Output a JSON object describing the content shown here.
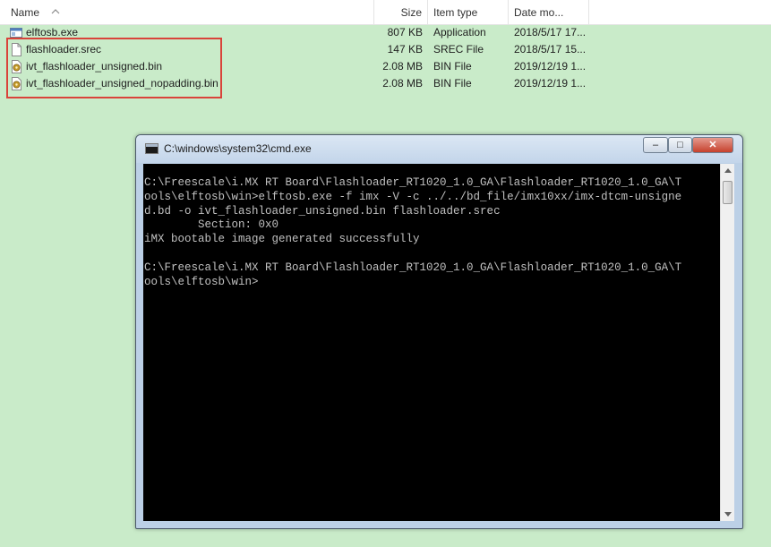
{
  "header": {
    "name": "Name",
    "size": "Size",
    "type": "Item type",
    "date": "Date mo..."
  },
  "files": [
    {
      "name": "elftosb.exe",
      "size": "807 KB",
      "type": "Application",
      "date": "2018/5/17 17...",
      "icon": "application-icon"
    },
    {
      "name": "flashloader.srec",
      "size": "147 KB",
      "type": "SREC File",
      "date": "2018/5/17 15...",
      "icon": "document-icon"
    },
    {
      "name": "ivt_flashloader_unsigned.bin",
      "size": "2.08 MB",
      "type": "BIN File",
      "date": "2019/12/19 1...",
      "icon": "bin-file-icon"
    },
    {
      "name": "ivt_flashloader_unsigned_nopadding.bin",
      "size": "2.08 MB",
      "type": "BIN File",
      "date": "2019/12/19 1...",
      "icon": "bin-file-icon"
    }
  ],
  "highlight_color": "#d9433a",
  "background_color": "#c9ebc9",
  "cmd": {
    "title": "C:\\windows\\system32\\cmd.exe",
    "min_label": "–",
    "max_label": "□",
    "close_label": "✕",
    "output": "C:\\Freescale\\i.MX RT Board\\Flashloader_RT1020_1.0_GA\\Flashloader_RT1020_1.0_GA\\T\nools\\elftosb\\win>elftosb.exe -f imx -V -c ../../bd_file/imx10xx/imx-dtcm-unsigne\nd.bd -o ivt_flashloader_unsigned.bin flashloader.srec\n        Section: 0x0\niMX bootable image generated successfully\n\nC:\\Freescale\\i.MX RT Board\\Flashloader_RT1020_1.0_GA\\Flashloader_RT1020_1.0_GA\\T\nools\\elftosb\\win>"
  }
}
